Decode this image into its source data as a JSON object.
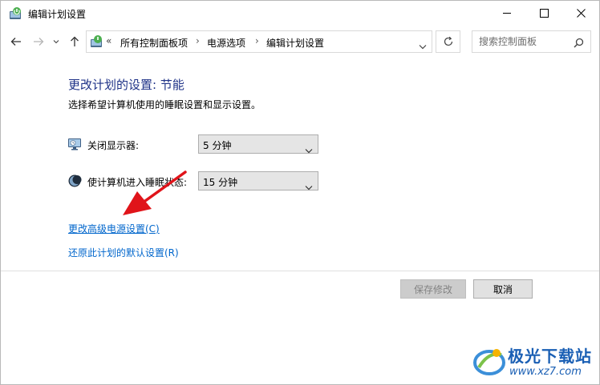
{
  "window": {
    "title": "编辑计划设置",
    "icon": "power-options-icon"
  },
  "nav": {
    "back_icon": "arrow-left-icon",
    "forward_icon": "arrow-right-icon",
    "recent_icon": "chevron-down-icon",
    "up_icon": "arrow-up-icon",
    "overflow": "«",
    "breadcrumbs": [
      "所有控制面板项",
      "电源选项",
      "编辑计划设置"
    ],
    "refresh_icon": "refresh-icon"
  },
  "search": {
    "placeholder": "搜索控制面板"
  },
  "content": {
    "heading": "更改计划的设置: 节能",
    "subtitle": "选择希望计算机使用的睡眠设置和显示设置。",
    "settings": [
      {
        "label": "关闭显示器:",
        "value": "5 分钟",
        "icon": "monitor-icon"
      },
      {
        "label": "使计算机进入睡眠状态:",
        "value": "15 分钟",
        "icon": "moon-icon"
      }
    ],
    "advanced_link": "更改高级电源设置(C)",
    "restore_link": "还原此计划的默认设置(R)"
  },
  "buttons": {
    "save": "保存修改",
    "cancel": "取消"
  },
  "annotation": {
    "arrow_color": "#e0141a"
  },
  "watermark": {
    "title": "极光下载站",
    "url": "www.xz7.com"
  },
  "colors": {
    "heading": "#1e3287",
    "link": "#0066cc"
  }
}
